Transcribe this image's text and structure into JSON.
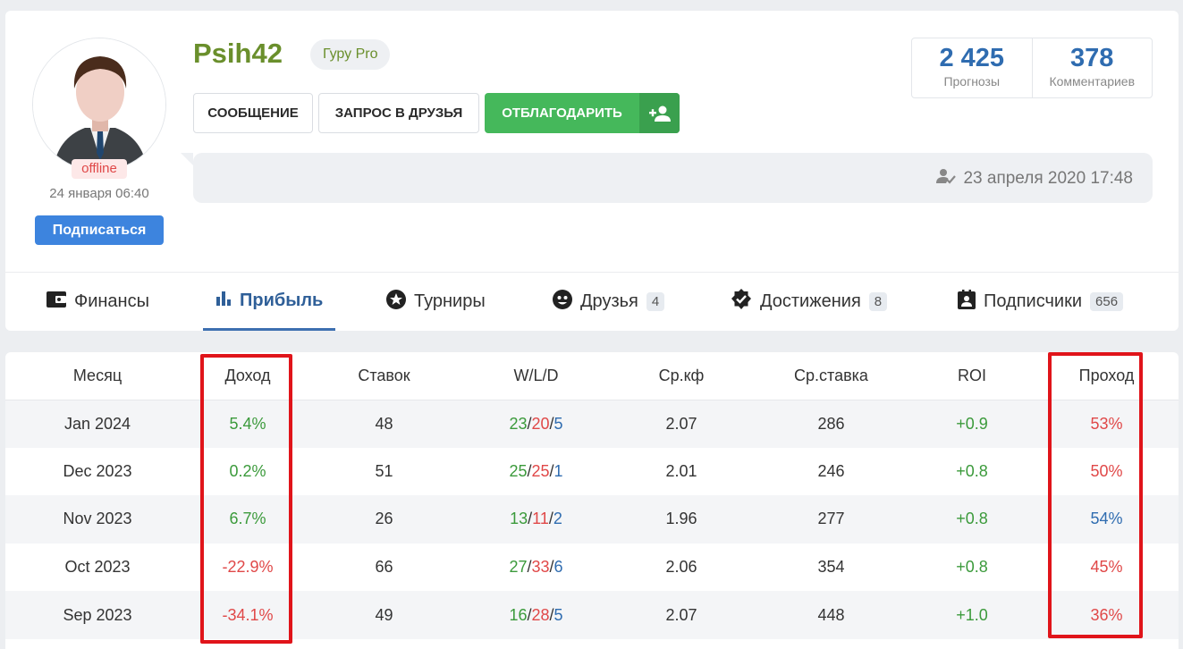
{
  "profile": {
    "username": "Psih42",
    "rank": "Гуру Pro",
    "online_status": "offline",
    "last_seen": "24 января 06:40",
    "subscribe_label": "Подписаться",
    "buttons": {
      "message": "СООБЩЕНИЕ",
      "friend_request": "ЗАПРОС В ДРУЗЬЯ",
      "thank": "ОТБЛАГОДАРИТЬ"
    },
    "stats": [
      {
        "value": "2 425",
        "label": "Прогнозы"
      },
      {
        "value": "378",
        "label": "Комментариев"
      }
    ],
    "status_date": "23 апреля 2020 17:48"
  },
  "tabs": [
    {
      "label": "Финансы",
      "icon": "wallet-icon"
    },
    {
      "label": "Прибыль",
      "icon": "bar-chart-icon",
      "active": true
    },
    {
      "label": "Турниры",
      "icon": "star-icon"
    },
    {
      "label": "Друзья",
      "icon": "smile-icon",
      "count": "4"
    },
    {
      "label": "Достижения",
      "icon": "badge-check-icon",
      "count": "8"
    },
    {
      "label": "Подписчики",
      "icon": "contact-icon",
      "count": "656"
    }
  ],
  "table": {
    "headers": [
      "Месяц",
      "Доход",
      "Ставок",
      "W/L/D",
      "Ср.кф",
      "Ср.ставка",
      "ROI",
      "Проход"
    ],
    "rows": [
      {
        "month": "Jan 2024",
        "income": "5.4%",
        "bets": "48",
        "w": "23",
        "l": "20",
        "d": "5",
        "avg_odds": "2.07",
        "avg_stake": "286",
        "roi": "+0.9",
        "pass": "53%"
      },
      {
        "month": "Dec 2023",
        "income": "0.2%",
        "bets": "51",
        "w": "25",
        "l": "25",
        "d": "1",
        "avg_odds": "2.01",
        "avg_stake": "246",
        "roi": "+0.8",
        "pass": "50%"
      },
      {
        "month": "Nov 2023",
        "income": "6.7%",
        "bets": "26",
        "w": "13",
        "l": "11",
        "d": "2",
        "avg_odds": "1.96",
        "avg_stake": "277",
        "roi": "+0.8",
        "pass": "54%"
      },
      {
        "month": "Oct 2023",
        "income": "-22.9%",
        "bets": "66",
        "w": "27",
        "l": "33",
        "d": "6",
        "avg_odds": "2.06",
        "avg_stake": "354",
        "roi": "+0.8",
        "pass": "45%"
      },
      {
        "month": "Sep 2023",
        "income": "-34.1%",
        "bets": "49",
        "w": "16",
        "l": "28",
        "d": "5",
        "avg_odds": "2.07",
        "avg_stake": "448",
        "roi": "+1.0",
        "pass": "36%"
      }
    ]
  },
  "colors": {
    "positive": "#3b9a3b",
    "negative": "#e04848",
    "blue": "#2f6cb0",
    "highlight": "#e0141a"
  }
}
